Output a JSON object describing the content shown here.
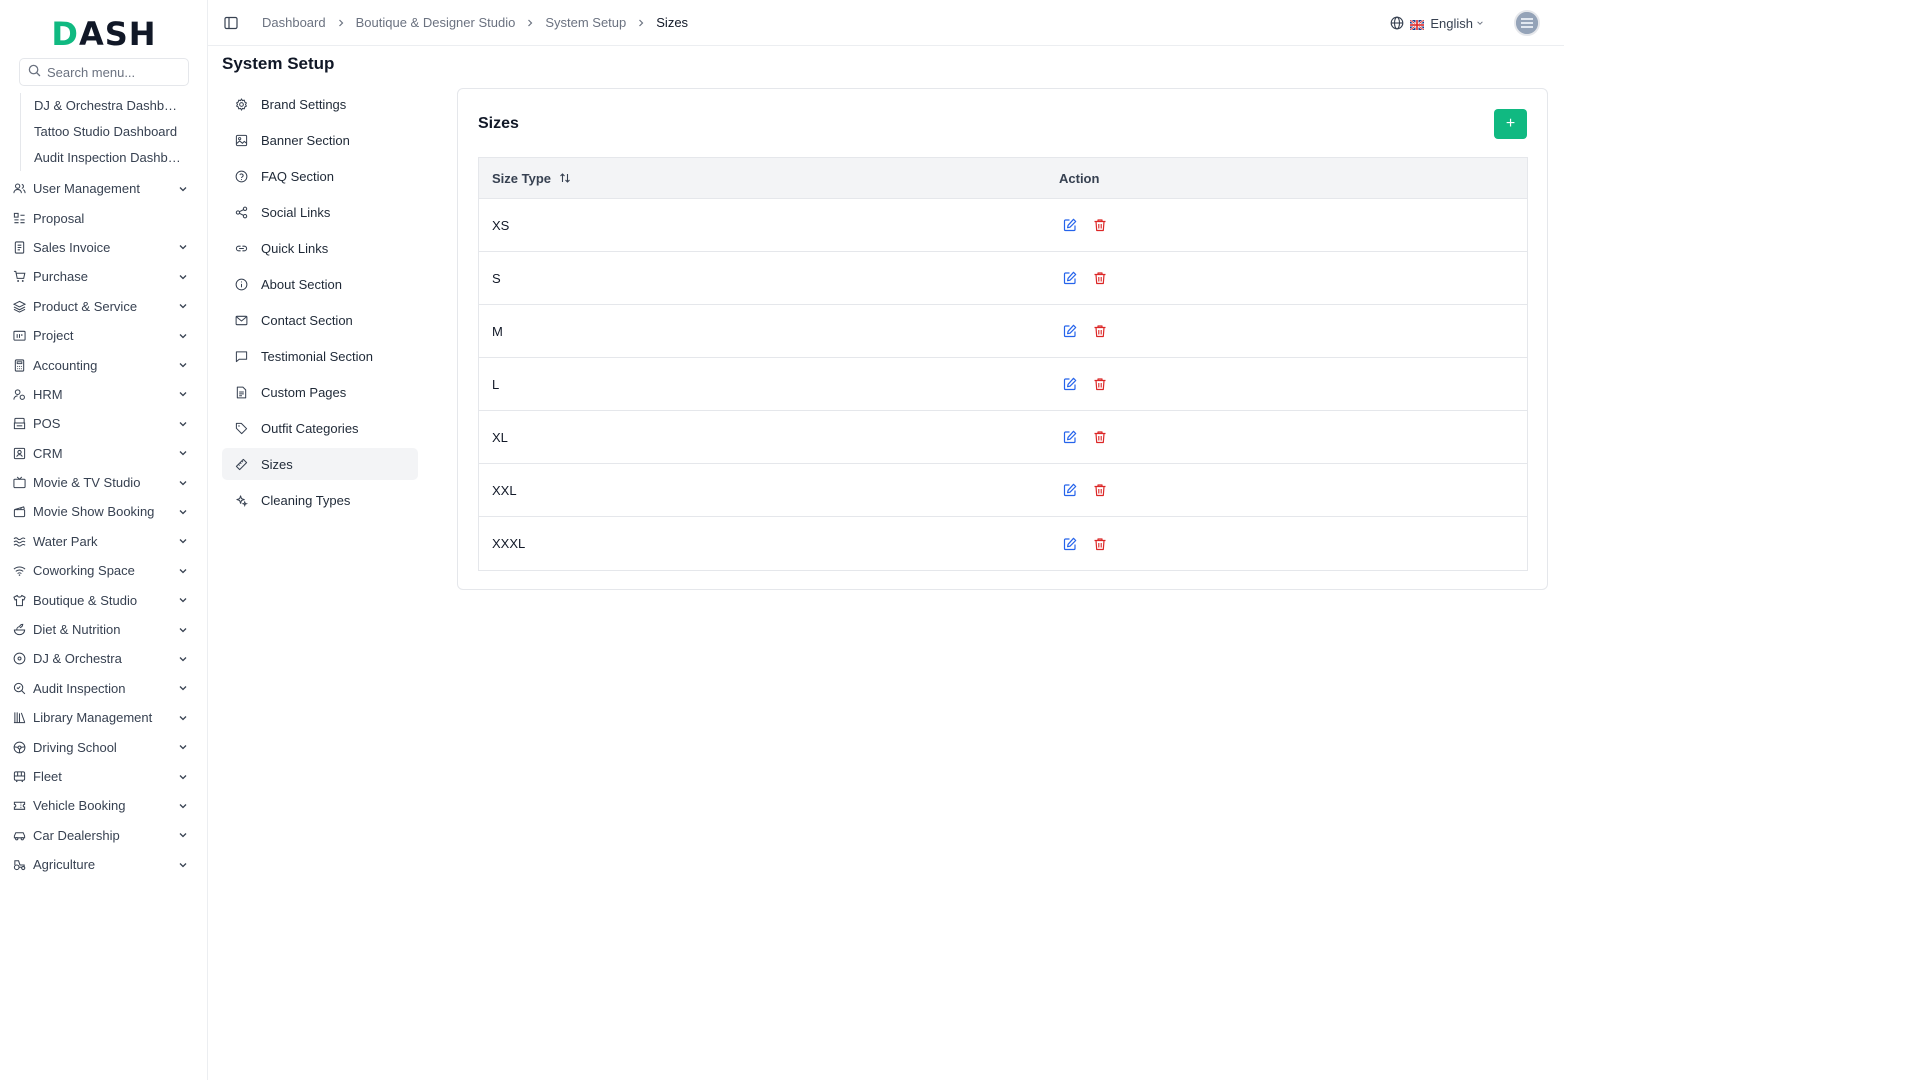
{
  "logo": {
    "text_d": "D",
    "text_rest": "ASH"
  },
  "search": {
    "placeholder": "Search menu..."
  },
  "sidebar_sub_items": [
    {
      "label": "DJ & Orchestra Dashboard"
    },
    {
      "label": "Tattoo Studio Dashboard"
    },
    {
      "label": "Audit Inspection Dashboard"
    }
  ],
  "sidebar_menu": [
    {
      "label": "User Management",
      "icon": "users-icon",
      "has_children": true
    },
    {
      "label": "Proposal",
      "icon": "proposal-icon",
      "has_children": false
    },
    {
      "label": "Sales Invoice",
      "icon": "invoice-icon",
      "has_children": true
    },
    {
      "label": "Purchase",
      "icon": "cart-icon",
      "has_children": true
    },
    {
      "label": "Product & Service",
      "icon": "layers-icon",
      "has_children": true
    },
    {
      "label": "Project",
      "icon": "project-icon",
      "has_children": true
    },
    {
      "label": "Accounting",
      "icon": "calculator-icon",
      "has_children": true
    },
    {
      "label": "HRM",
      "icon": "hrm-icon",
      "has_children": true
    },
    {
      "label": "POS",
      "icon": "pos-icon",
      "has_children": true
    },
    {
      "label": "CRM",
      "icon": "crm-icon",
      "has_children": true
    },
    {
      "label": "Movie & TV Studio",
      "icon": "tv-icon",
      "has_children": true
    },
    {
      "label": "Movie Show Booking",
      "icon": "clapperboard-icon",
      "has_children": true
    },
    {
      "label": "Water Park",
      "icon": "waves-icon",
      "has_children": true
    },
    {
      "label": "Coworking Space",
      "icon": "wifi-icon",
      "has_children": true
    },
    {
      "label": "Boutique & Studio",
      "icon": "shirt-icon",
      "has_children": true
    },
    {
      "label": "Diet & Nutrition",
      "icon": "salad-icon",
      "has_children": true
    },
    {
      "label": "DJ & Orchestra",
      "icon": "disc-icon",
      "has_children": true
    },
    {
      "label": "Audit Inspection",
      "icon": "search-check-icon",
      "has_children": true
    },
    {
      "label": "Library Management",
      "icon": "library-icon",
      "has_children": true
    },
    {
      "label": "Driving School",
      "icon": "steering-wheel-icon",
      "has_children": true
    },
    {
      "label": "Fleet",
      "icon": "bus-icon",
      "has_children": true
    },
    {
      "label": "Vehicle Booking",
      "icon": "ticket-icon",
      "has_children": true
    },
    {
      "label": "Car Dealership",
      "icon": "car-icon",
      "has_children": true
    },
    {
      "label": "Agriculture",
      "icon": "tractor-icon",
      "has_children": true
    }
  ],
  "breadcrumb": [
    {
      "label": "Dashboard"
    },
    {
      "label": "Boutique & Designer Studio"
    },
    {
      "label": "System Setup"
    },
    {
      "label": "Sizes"
    }
  ],
  "language": {
    "label": "English"
  },
  "page": {
    "title": "System Setup"
  },
  "setup_nav": [
    {
      "label": "Brand Settings",
      "icon": "settings-icon",
      "active": false
    },
    {
      "label": "Banner Section",
      "icon": "image-icon",
      "active": false
    },
    {
      "label": "FAQ Section",
      "icon": "help-circle-icon",
      "active": false
    },
    {
      "label": "Social Links",
      "icon": "share-icon",
      "active": false
    },
    {
      "label": "Quick Links",
      "icon": "link-icon",
      "active": false
    },
    {
      "label": "About Section",
      "icon": "info-icon",
      "active": false
    },
    {
      "label": "Contact Section",
      "icon": "mail-icon",
      "active": false
    },
    {
      "label": "Testimonial Section",
      "icon": "message-square-icon",
      "active": false
    },
    {
      "label": "Custom Pages",
      "icon": "file-text-icon",
      "active": false
    },
    {
      "label": "Outfit Categories",
      "icon": "tag-icon",
      "active": false
    },
    {
      "label": "Sizes",
      "icon": "ruler-icon",
      "active": true
    },
    {
      "label": "Cleaning Types",
      "icon": "sparkles-icon",
      "active": false
    }
  ],
  "card": {
    "title": "Sizes",
    "add_label": "+",
    "columns": {
      "size_type": "Size Type",
      "action": "Action"
    },
    "rows": [
      {
        "size": "XS"
      },
      {
        "size": "S"
      },
      {
        "size": "M"
      },
      {
        "size": "L"
      },
      {
        "size": "XL"
      },
      {
        "size": "XXL"
      },
      {
        "size": "XXXL"
      }
    ]
  },
  "colors": {
    "accent": "#10b981",
    "edit": "#2563eb",
    "delete": "#dc2626"
  }
}
